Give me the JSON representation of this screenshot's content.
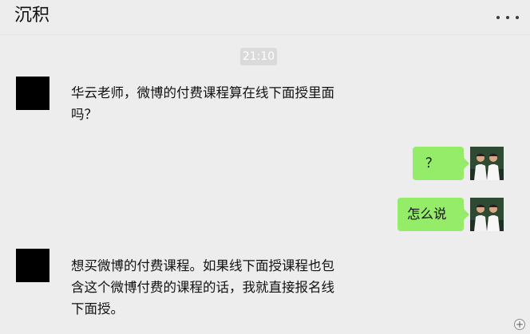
{
  "header": {
    "title": "沉积",
    "more_icon": "more-dots-icon"
  },
  "chat": {
    "timestamp": "21:10",
    "messages": [
      {
        "side": "left",
        "text": "华云老师，微博的付费课程算在线下面授里面吗？"
      },
      {
        "side": "right",
        "text": "？"
      },
      {
        "side": "right",
        "text": "怎么说"
      },
      {
        "side": "left",
        "text": "想买微博的付费课程。如果线下面授课程也包含这个微博付费的课程的话，我就直接报名线下面授。"
      }
    ]
  },
  "colors": {
    "background": "#ededed",
    "self_bubble": "#95ec69",
    "other_bubble": "#ffffff",
    "timestamp_bg": "#dadada"
  }
}
